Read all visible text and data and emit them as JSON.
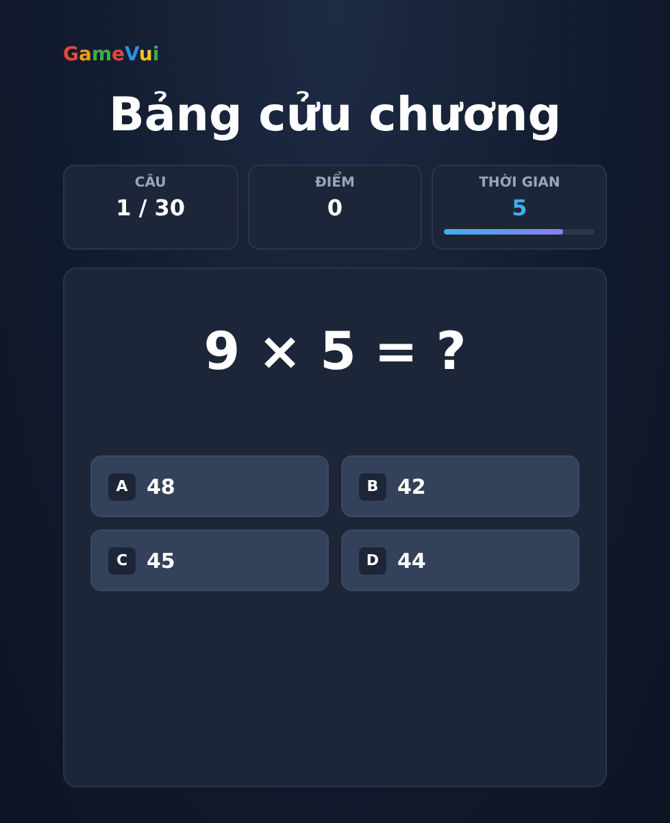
{
  "logo": {
    "letters": [
      {
        "char": "G",
        "color": "#e8453c"
      },
      {
        "char": "a",
        "color": "#f29a1f"
      },
      {
        "char": "m",
        "color": "#3cae4a"
      },
      {
        "char": "e",
        "color": "#e8453c"
      },
      {
        "char": "V",
        "color": "#2f8fe0"
      },
      {
        "char": "u",
        "color": "#f2c31f"
      },
      {
        "char": "i",
        "color": "#3cae4a"
      }
    ]
  },
  "title": "Bảng cửu chương",
  "stats": [
    {
      "label": "CÂU",
      "value": "1 / 30",
      "kind": "plain"
    },
    {
      "label": "ĐIỂM",
      "value": "0",
      "kind": "plain"
    },
    {
      "label": "THỜI GIAN",
      "value": "5",
      "kind": "timer",
      "level": 0.79
    }
  ],
  "question": "9 × 5 = ?",
  "options": [
    {
      "key": "A",
      "answer": "48"
    },
    {
      "key": "B",
      "answer": "42"
    },
    {
      "key": "C",
      "answer": "45"
    },
    {
      "key": "D",
      "answer": "44"
    }
  ]
}
